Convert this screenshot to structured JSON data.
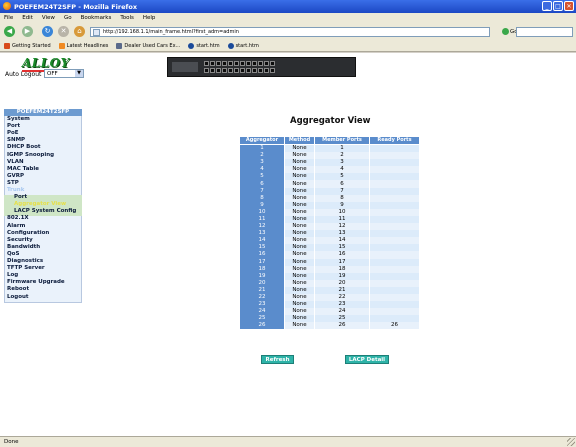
{
  "window": {
    "title": "POEFEM24T2SFP - Mozilla Firefox"
  },
  "menu": [
    "File",
    "Edit",
    "View",
    "Go",
    "Bookmarks",
    "Tools",
    "Help"
  ],
  "nav": {
    "url": "http://192.168.1.1/main_frame.html?first_adm=admin",
    "go_label": "Go"
  },
  "bookmarks": [
    {
      "label": "Getting Started",
      "color": "#d84a1a"
    },
    {
      "label": "Latest Headlines",
      "color": "#f08a22"
    },
    {
      "label": "Dealer Used Cars Ex...",
      "color": "#5a6a8a"
    },
    {
      "label": "start.htm",
      "color": "#1a4a9a"
    },
    {
      "label": "start.htm",
      "color": "#1a4a9a"
    }
  ],
  "header": {
    "logo": "ALLOY",
    "auto_logout_label": "Auto Logout",
    "auto_logout_value": "OFF"
  },
  "sidebar": {
    "title": "POEFEM24T2SFP",
    "items": [
      {
        "label": "System",
        "level": 0
      },
      {
        "label": "Port",
        "level": 0
      },
      {
        "label": "PoE",
        "level": 0
      },
      {
        "label": "SNMP",
        "level": 0
      },
      {
        "label": "DHCP Boot",
        "level": 0
      },
      {
        "label": "IGMP Snooping",
        "level": 0
      },
      {
        "label": "VLAN",
        "level": 0
      },
      {
        "label": "MAC Table",
        "level": 0
      },
      {
        "label": "GVRP",
        "level": 0
      },
      {
        "label": "STP",
        "level": 0
      },
      {
        "label": "Trunk",
        "level": 0,
        "state": "open"
      },
      {
        "label": "Port",
        "level": 1
      },
      {
        "label": "Aggregator View",
        "level": 1,
        "state": "selected"
      },
      {
        "label": "LACP System Config",
        "level": 1
      },
      {
        "label": "802.1X",
        "level": 0
      },
      {
        "label": "Alarm",
        "level": 0
      },
      {
        "label": "Configuration",
        "level": 0
      },
      {
        "label": "Security",
        "level": 0
      },
      {
        "label": "Bandwidth",
        "level": 0
      },
      {
        "label": "QoS",
        "level": 0
      },
      {
        "label": "Diagnostics",
        "level": 0
      },
      {
        "label": "TFTP Server",
        "level": 0
      },
      {
        "label": "Log",
        "level": 0
      },
      {
        "label": "Firmware Upgrade",
        "level": 0
      },
      {
        "label": "Reboot",
        "level": 0
      },
      {
        "label": "Logout",
        "level": 0
      }
    ]
  },
  "main": {
    "title": "Aggregator View",
    "columns": [
      "Aggregator",
      "Method",
      "Member Ports",
      "Ready Ports"
    ],
    "rows": [
      [
        "1",
        "None",
        "1",
        ""
      ],
      [
        "2",
        "None",
        "2",
        ""
      ],
      [
        "3",
        "None",
        "3",
        ""
      ],
      [
        "4",
        "None",
        "4",
        ""
      ],
      [
        "5",
        "None",
        "5",
        ""
      ],
      [
        "6",
        "None",
        "6",
        ""
      ],
      [
        "7",
        "None",
        "7",
        ""
      ],
      [
        "8",
        "None",
        "8",
        ""
      ],
      [
        "9",
        "None",
        "9",
        ""
      ],
      [
        "10",
        "None",
        "10",
        ""
      ],
      [
        "11",
        "None",
        "11",
        ""
      ],
      [
        "12",
        "None",
        "12",
        ""
      ],
      [
        "13",
        "None",
        "13",
        ""
      ],
      [
        "14",
        "None",
        "14",
        ""
      ],
      [
        "15",
        "None",
        "15",
        ""
      ],
      [
        "16",
        "None",
        "16",
        ""
      ],
      [
        "17",
        "None",
        "17",
        ""
      ],
      [
        "18",
        "None",
        "18",
        ""
      ],
      [
        "19",
        "None",
        "19",
        ""
      ],
      [
        "20",
        "None",
        "20",
        ""
      ],
      [
        "21",
        "None",
        "21",
        ""
      ],
      [
        "22",
        "None",
        "22",
        ""
      ],
      [
        "23",
        "None",
        "23",
        ""
      ],
      [
        "24",
        "None",
        "24",
        ""
      ],
      [
        "25",
        "None",
        "25",
        ""
      ],
      [
        "26",
        "None",
        "26",
        "26"
      ]
    ],
    "refresh_label": "Refresh",
    "lacp_detail_label": "LACP Detail"
  },
  "status": {
    "text": "Done"
  }
}
